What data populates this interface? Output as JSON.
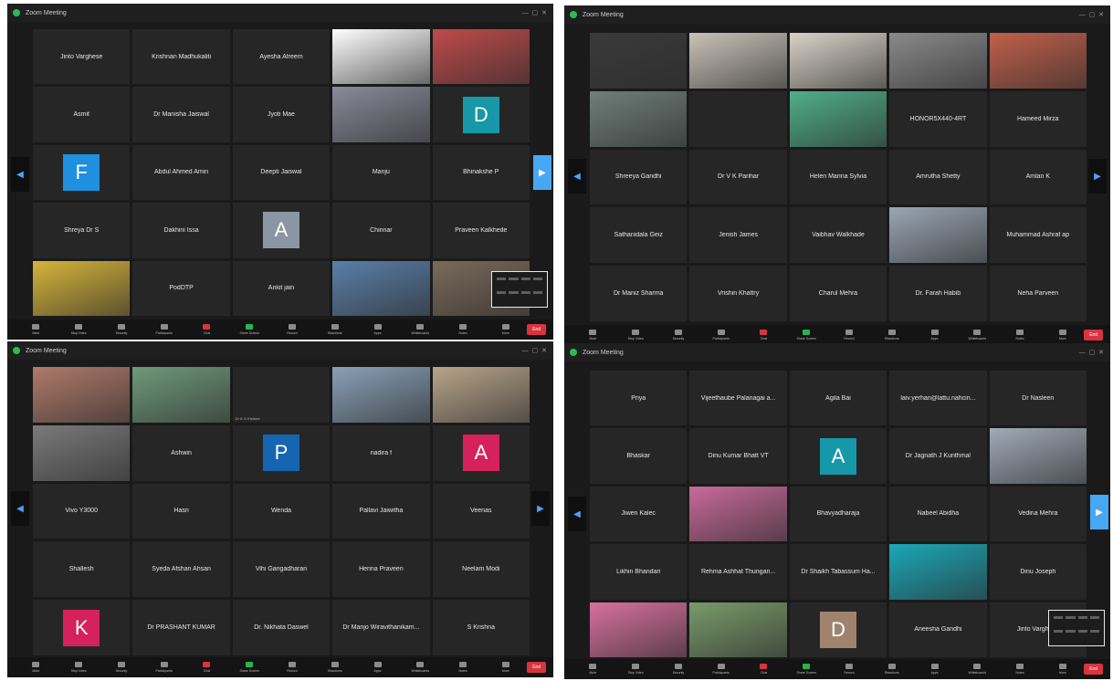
{
  "colors": {
    "avatar_blue": "#1f8fe0",
    "avatar_teal": "#1798a8",
    "avatar_gray": "#8a96a3",
    "avatar_navy": "#1565b0",
    "avatar_pink": "#d5215c",
    "avatar_brown": "#a0836d",
    "end_red": "#d8343f",
    "accent_green": "#27b44b"
  },
  "windows": [
    {
      "title": "Zoom Meeting",
      "tiles": [
        {
          "name": "Jinto Varghese",
          "label": ""
        },
        {
          "name": "Krishnan Madhukaliti",
          "label": ""
        },
        {
          "name": "Ayesha Afreem",
          "label": ""
        },
        {
          "name": "",
          "label": "",
          "video": "#ffffff"
        },
        {
          "name": "",
          "label": "",
          "video": "#c04a4a"
        },
        {
          "name": "Asmit",
          "label": ""
        },
        {
          "name": "Dr Manisha Jaiswal",
          "label": ""
        },
        {
          "name": "Jyoti Mae",
          "label": ""
        },
        {
          "name": "",
          "label": "",
          "video": "#8a8a9a"
        },
        {
          "name": "",
          "label": "",
          "avatar": "D",
          "avatar_color": "#1798a8"
        },
        {
          "name": "",
          "label": "",
          "avatar": "F",
          "avatar_color": "#1f8fe0"
        },
        {
          "name": "Abdul Ahmed Amin",
          "label": ""
        },
        {
          "name": "Deepti Jaiswal",
          "label": ""
        },
        {
          "name": "Manju",
          "label": ""
        },
        {
          "name": "Bhinakshe P",
          "label": ""
        },
        {
          "name": "Shreya Dr S",
          "label": ""
        },
        {
          "name": "Dakhini Issa",
          "label": ""
        },
        {
          "name": "",
          "label": "",
          "avatar": "A",
          "avatar_color": "#8a96a3"
        },
        {
          "name": "Chinnar",
          "label": ""
        },
        {
          "name": "Praveen Kalkhede",
          "label": ""
        },
        {
          "name": "",
          "label": "",
          "video": "#d6b43a"
        },
        {
          "name": "PodDTP",
          "label": ""
        },
        {
          "name": "Ankit jain",
          "label": ""
        },
        {
          "name": "",
          "label": "",
          "video": "#5a7fa8"
        },
        {
          "name": "",
          "label": "",
          "video": "#7a6a5a"
        }
      ],
      "toolbar": [
        "Mute",
        "Stop Video",
        "Security",
        "Participants",
        "Chat",
        "Share Screen",
        "Record",
        "Reactions",
        "Apps",
        "Whiteboards",
        "Notes",
        "More"
      ],
      "end_label": "End"
    },
    {
      "title": "Zoom Meeting",
      "tiles": [
        {
          "name": "",
          "label": "",
          "video": "#3a3a3a"
        },
        {
          "name": "",
          "label": "",
          "video": "#c9c2b8"
        },
        {
          "name": "",
          "label": "",
          "video": "#d8d2c8"
        },
        {
          "name": "",
          "label": "",
          "video": "#8a8a8a"
        },
        {
          "name": "",
          "label": "",
          "video": "#c2604a"
        },
        {
          "name": "",
          "label": "",
          "video": "#6f7f7a"
        },
        {
          "name": "",
          "label": ""
        },
        {
          "name": "",
          "label": "",
          "video": "#4fae8a"
        },
        {
          "name": "HONOR5X440-4RT",
          "label": ""
        },
        {
          "name": "Hameed Mirza",
          "label": ""
        },
        {
          "name": "Shreeya Gandhi",
          "label": ""
        },
        {
          "name": "Dr V K Parihar",
          "label": ""
        },
        {
          "name": "Helen Marina Sylvia",
          "label": ""
        },
        {
          "name": "Amrutha Shetty",
          "label": ""
        },
        {
          "name": "Amlan K",
          "label": ""
        },
        {
          "name": "Sathanidala Geiz",
          "label": ""
        },
        {
          "name": "Jenish James",
          "label": ""
        },
        {
          "name": "Vaibhav Walkhade",
          "label": ""
        },
        {
          "name": "",
          "label": "",
          "video": "#9aa6b4"
        },
        {
          "name": "Muhammad Ashraf ap",
          "label": ""
        },
        {
          "name": "Dr Maniz Sharma",
          "label": ""
        },
        {
          "name": "Vrishin Khattry",
          "label": ""
        },
        {
          "name": "Charul Mehra",
          "label": ""
        },
        {
          "name": "Dr. Farah Habib",
          "label": ""
        },
        {
          "name": "Neha Parveen",
          "label": ""
        }
      ],
      "toolbar": [
        "Mute",
        "Stop Video",
        "Security",
        "Participants",
        "Chat",
        "Share Screen",
        "Record",
        "Reactions",
        "Apps",
        "Whiteboards",
        "Notes",
        "More"
      ],
      "end_label": "End"
    },
    {
      "title": "Zoom Meeting",
      "tiles": [
        {
          "name": "",
          "label": "",
          "video": "#b07a6a"
        },
        {
          "name": "",
          "label": "",
          "video": "#6f9a7a"
        },
        {
          "name": "",
          "label": "Dr K G Kishore"
        },
        {
          "name": "",
          "label": "",
          "video": "#8aa0b8"
        },
        {
          "name": "",
          "label": "",
          "video": "#b8a48a"
        },
        {
          "name": "",
          "label": "",
          "video": "#7a7a7a"
        },
        {
          "name": "Ashwin",
          "label": ""
        },
        {
          "name": "",
          "label": "",
          "avatar": "P",
          "avatar_color": "#1565b0"
        },
        {
          "name": "nadira f",
          "label": ""
        },
        {
          "name": "",
          "label": "",
          "avatar": "A",
          "avatar_color": "#d5215c"
        },
        {
          "name": "Vivo Y3000",
          "label": ""
        },
        {
          "name": "Hasri",
          "label": ""
        },
        {
          "name": "Wenda",
          "label": ""
        },
        {
          "name": "Pallavi Jaiwitha",
          "label": ""
        },
        {
          "name": "Veenas",
          "label": ""
        },
        {
          "name": "Shallesh",
          "label": ""
        },
        {
          "name": "Syeda Afshan Ahsan",
          "label": ""
        },
        {
          "name": "Vihi Gangadharan",
          "label": ""
        },
        {
          "name": "Henna Praveen",
          "label": ""
        },
        {
          "name": "Neelam Modi",
          "label": ""
        },
        {
          "name": "",
          "label": "",
          "avatar": "K",
          "avatar_color": "#d5215c"
        },
        {
          "name": "Dr PRASHANT KUMAR",
          "label": ""
        },
        {
          "name": "Dr. Nikhata Daswel",
          "label": ""
        },
        {
          "name": "Dr Manjo Wiravithanikam...",
          "label": ""
        },
        {
          "name": "S Krishna",
          "label": ""
        }
      ],
      "toolbar": [
        "Mute",
        "Stop Video",
        "Security",
        "Participants",
        "Chat",
        "Share Screen",
        "Record",
        "Reactions",
        "Apps",
        "Whiteboards",
        "Notes",
        "More"
      ],
      "end_label": "End"
    },
    {
      "title": "Zoom Meeting",
      "tiles": [
        {
          "name": "Priya",
          "label": ""
        },
        {
          "name": "Vijeethaube Palanagai a...",
          "label": ""
        },
        {
          "name": "Agila Bai",
          "label": ""
        },
        {
          "name": "laiv.yerhan@lattu.nahcin...",
          "label": ""
        },
        {
          "name": "Dr Nasleen",
          "label": ""
        },
        {
          "name": "Bhaskar",
          "label": ""
        },
        {
          "name": "Dinu Kumar Bhatt VT",
          "label": ""
        },
        {
          "name": "",
          "label": "",
          "avatar": "A",
          "avatar_color": "#1798a8"
        },
        {
          "name": "Dr Jagnath J Kunthmal",
          "label": ""
        },
        {
          "name": "",
          "label": "",
          "video": "#a0aab8"
        },
        {
          "name": "Jiwen Kalec",
          "label": ""
        },
        {
          "name": "",
          "label": "",
          "video": "#c86a9a"
        },
        {
          "name": "Bhavyadharaja",
          "label": ""
        },
        {
          "name": "Nabeel Abidha",
          "label": ""
        },
        {
          "name": "Vedina Mehra",
          "label": ""
        },
        {
          "name": "Likhin Bhandari",
          "label": ""
        },
        {
          "name": "Rehma Ashhat Thungan...",
          "label": ""
        },
        {
          "name": "Dr Shaikh Tabassum Ha...",
          "label": ""
        },
        {
          "name": "",
          "label": "",
          "video": "#1aa8b8"
        },
        {
          "name": "Dinu Joseph",
          "label": ""
        },
        {
          "name": "",
          "label": "",
          "video": "#d870a0"
        },
        {
          "name": "",
          "label": "",
          "video": "#7a9a6a"
        },
        {
          "name": "",
          "label": "",
          "avatar": "D",
          "avatar_color": "#a0836d"
        },
        {
          "name": "Aneesha Gandhi",
          "label": ""
        },
        {
          "name": "Jinto Varghese",
          "label": ""
        }
      ],
      "toolbar": [
        "Mute",
        "Stop Video",
        "Security",
        "Participants",
        "Chat",
        "Share Screen",
        "Record",
        "Reactions",
        "Apps",
        "Whiteboards",
        "Notes",
        "More"
      ],
      "end_label": "End"
    }
  ]
}
